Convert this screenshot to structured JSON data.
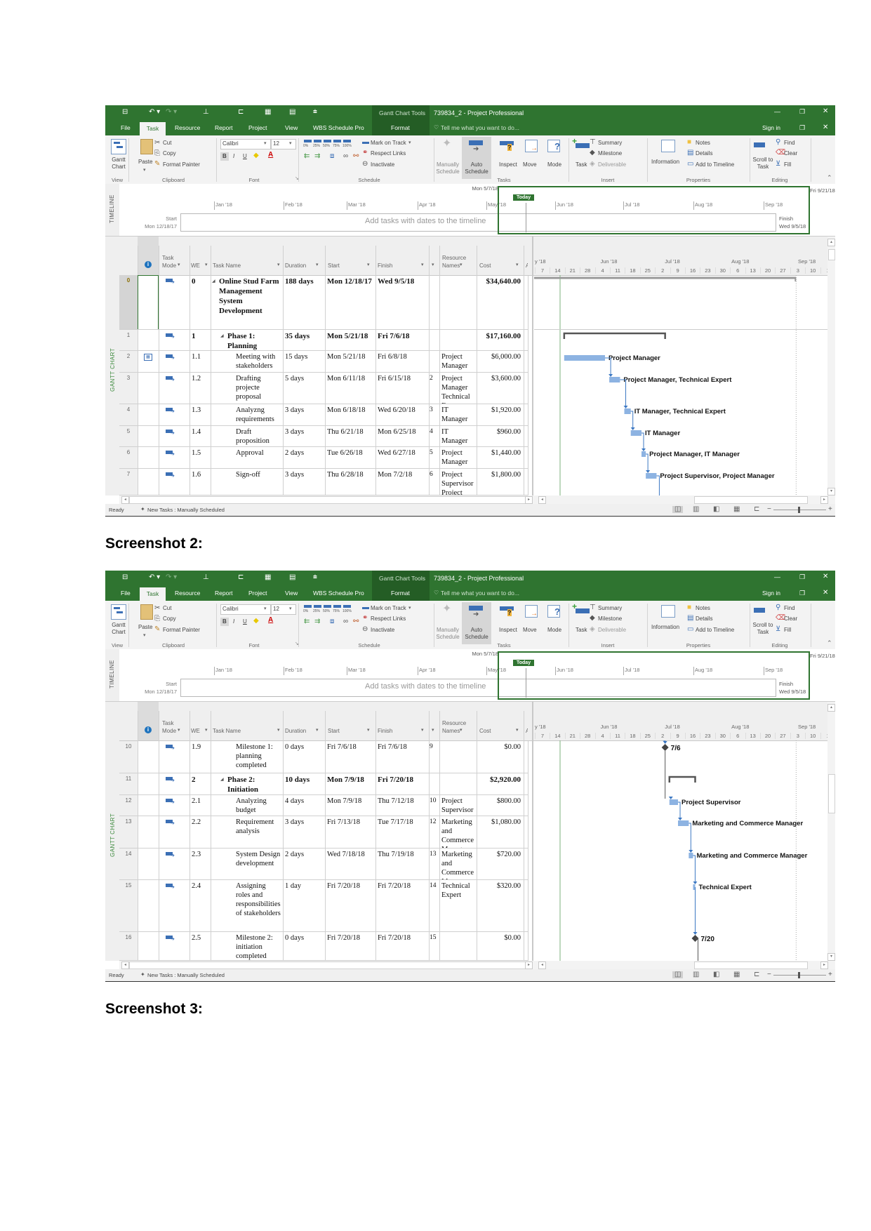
{
  "document": {
    "heading_2": "Screenshot 2:",
    "heading_3": "Screenshot 3:"
  },
  "app": {
    "quick_access_icons": [
      "save-icon",
      "undo-icon",
      "redo-icon",
      "org-chart-icon",
      "outline-icon",
      "calendar-grid-icon",
      "table-icon",
      "customize-icon"
    ],
    "contextual_tab_group": "Gantt Chart Tools",
    "window_title": "739834_2 - Project Professional",
    "tabs": [
      "File",
      "Task",
      "Resource",
      "Report",
      "Project",
      "View",
      "WBS Schedule Pro",
      "Format"
    ],
    "active_tab": "Task",
    "tell_me_placeholder": "Tell me what you want to do...",
    "sign_in": "Sign in",
    "ribbon": {
      "groups": [
        "View",
        "Clipboard",
        "Font",
        "Schedule",
        "Tasks",
        "Insert",
        "Properties",
        "Editing"
      ],
      "gantt_chart": "Gantt Chart",
      "paste": "Paste",
      "cut": "Cut",
      "copy": "Copy",
      "format_painter": "Format Painter",
      "font_name": "Calibri",
      "font_size": "12",
      "bold": "B",
      "italic": "I",
      "underline": "U",
      "percent_complete": [
        "0%",
        "25%",
        "50%",
        "75%",
        "100%"
      ],
      "mark_on_track": "Mark on Track",
      "respect_links": "Respect Links",
      "inactivate": "Inactivate",
      "manually_schedule": "Manually Schedule",
      "auto_schedule": "Auto Schedule",
      "inspect": "Inspect",
      "move": "Move",
      "mode": "Mode",
      "task": "Task",
      "summary": "Summary",
      "milestone": "Milestone",
      "deliverable": "Deliverable",
      "information": "Information",
      "notes": "Notes",
      "details": "Details",
      "add_to_timeline": "Add to Timeline",
      "scroll_to_task": "Scroll to Task",
      "find": "Find",
      "clear": "Clear",
      "fill": "Fill"
    },
    "timeline": {
      "side_label": "TIMELINE",
      "current_date": "Mon 5/7/18",
      "today_badge": "Today",
      "months": [
        "Jan '18",
        "Feb '18",
        "Mar '18",
        "Apr '18",
        "May '18",
        "Jun '18",
        "Jul '18",
        "Aug '18",
        "Sep '18"
      ],
      "start_label": "Start",
      "start_date": "Mon 12/18/17",
      "finish_label": "Finish",
      "finish_date": "Wed 9/5/18",
      "placeholder": "Add tasks with dates to the timeline",
      "view_end_date": "Fri 9/21/18"
    },
    "side_label": "GANTT CHART",
    "columns": {
      "indicators_icon": "info-icon",
      "task_mode": "Task\nMode",
      "wbs": "WE",
      "task_name": "Task Name",
      "duration": "Duration",
      "start": "Start",
      "finish": "Finish",
      "resource_names": "Resource\nNames",
      "cost": "Cost",
      "add_new_column": "A"
    },
    "gantt_timescale": {
      "months": [
        "y '18",
        "Jun '18",
        "Jul '18",
        "Aug '18",
        "Sep '18"
      ],
      "weeks": [
        "7",
        "14",
        "21",
        "28",
        "4",
        "11",
        "18",
        "25",
        "2",
        "9",
        "16",
        "23",
        "30",
        "6",
        "13",
        "20",
        "27",
        "3",
        "10",
        "1"
      ]
    },
    "status": {
      "ready": "Ready",
      "new_tasks": "New Tasks : Manually Scheduled",
      "view_icons": [
        "gantt-view-icon",
        "task-usage-icon",
        "team-planner-icon",
        "resource-sheet-icon",
        "report-icon"
      ],
      "zoom_minus": "−",
      "zoom_plus": "+"
    },
    "colors": {
      "title_bar": "#2f7430",
      "contextual_band": "#245d25",
      "task_bar": "#8db3e2",
      "link_line": "#3c78c3",
      "today_line": "#7cb27c",
      "summary_bar": "#555555"
    }
  },
  "screenshots": [
    {
      "rows": [
        {
          "id": "0",
          "indicator": "",
          "wbs": "0",
          "name": "Online Stud Farm Management System Development",
          "duration": "188 days",
          "start": "Mon 12/18/17",
          "finish": "Wed 9/5/18",
          "predecessors": "",
          "resource_names": "",
          "cost": "$34,640.00",
          "type": "project-summary",
          "level": 0,
          "bar_label": ""
        },
        {
          "id": "1",
          "indicator": "",
          "wbs": "1",
          "name": "Phase 1: Planning",
          "duration": "35 days",
          "start": "Mon 5/21/18",
          "finish": "Fri 7/6/18",
          "predecessors": "",
          "resource_names": "",
          "cost": "$17,160.00",
          "type": "summary",
          "level": 1,
          "bar_label": ""
        },
        {
          "id": "2",
          "indicator": "calendar-icon",
          "wbs": "1.1",
          "name": "Meeting with stakeholders",
          "duration": "15 days",
          "start": "Mon 5/21/18",
          "finish": "Fri 6/8/18",
          "predecessors": "",
          "resource_names": "Project Manager",
          "cost": "$6,000.00",
          "type": "task",
          "level": 2,
          "bar_label": "Project Manager"
        },
        {
          "id": "3",
          "indicator": "",
          "wbs": "1.2",
          "name": "Drafting projecte proposal",
          "duration": "5 days",
          "start": "Mon 6/11/18",
          "finish": "Fri 6/15/18",
          "predecessors": "2",
          "resource_names": "Project Manager Technical Expert",
          "cost": "$3,600.00",
          "type": "task",
          "level": 2,
          "bar_label": "Project Manager, Technical Expert"
        },
        {
          "id": "4",
          "indicator": "",
          "wbs": "1.3",
          "name": "Analyzng requirements",
          "duration": "3 days",
          "start": "Mon 6/18/18",
          "finish": "Wed 6/20/18",
          "predecessors": "3",
          "resource_names": "IT Manager Technical Expert",
          "cost": "$1,920.00",
          "type": "task",
          "level": 2,
          "bar_label": "IT Manager, Technical Expert"
        },
        {
          "id": "5",
          "indicator": "",
          "wbs": "1.4",
          "name": "Draft proposition",
          "duration": "3 days",
          "start": "Thu 6/21/18",
          "finish": "Mon 6/25/18",
          "predecessors": "4",
          "resource_names": "IT Manager",
          "cost": "$960.00",
          "type": "task",
          "level": 2,
          "bar_label": "IT Manager"
        },
        {
          "id": "6",
          "indicator": "",
          "wbs": "1.5",
          "name": "Approval",
          "duration": "2 days",
          "start": "Tue 6/26/18",
          "finish": "Wed 6/27/18",
          "predecessors": "5",
          "resource_names": "Project Manager IT Manager",
          "cost": "$1,440.00",
          "type": "task",
          "level": 2,
          "bar_label": "Project Manager, IT Manager"
        },
        {
          "id": "7",
          "indicator": "",
          "wbs": "1.6",
          "name": "Sign-off",
          "duration": "3 days",
          "start": "Thu 6/28/18",
          "finish": "Mon 7/2/18",
          "predecessors": "6",
          "resource_names": "Project Supervisor Project Manager",
          "cost": "$1,800.00",
          "type": "task",
          "level": 2,
          "bar_label": "Project Supervisor, Project Manager"
        }
      ]
    },
    {
      "rows": [
        {
          "id": "10",
          "indicator": "",
          "wbs": "1.9",
          "name": "Milestone 1: planning completed",
          "duration": "0 days",
          "start": "Fri 7/6/18",
          "finish": "Fri 7/6/18",
          "predecessors": "9",
          "resource_names": "",
          "cost": "$0.00",
          "type": "milestone",
          "level": 2,
          "bar_label": "7/6"
        },
        {
          "id": "11",
          "indicator": "",
          "wbs": "2",
          "name": "Phase 2: Initiation",
          "duration": "10 days",
          "start": "Mon 7/9/18",
          "finish": "Fri 7/20/18",
          "predecessors": "",
          "resource_names": "",
          "cost": "$2,920.00",
          "type": "summary",
          "level": 1,
          "bar_label": ""
        },
        {
          "id": "12",
          "indicator": "",
          "wbs": "2.1",
          "name": "Analyzing budget",
          "duration": "4 days",
          "start": "Mon 7/9/18",
          "finish": "Thu 7/12/18",
          "predecessors": "10",
          "resource_names": "Project Supervisor",
          "cost": "$800.00",
          "type": "task",
          "level": 2,
          "bar_label": "Project Supervisor"
        },
        {
          "id": "13",
          "indicator": "",
          "wbs": "2.2",
          "name": "Requirement analysis",
          "duration": "3 days",
          "start": "Fri 7/13/18",
          "finish": "Tue 7/17/18",
          "predecessors": "12",
          "resource_names": "Marketing and Commerce Manager",
          "cost": "$1,080.00",
          "type": "task",
          "level": 2,
          "bar_label": "Marketing and Commerce Manager"
        },
        {
          "id": "14",
          "indicator": "",
          "wbs": "2.3",
          "name": "System Design development",
          "duration": "2 days",
          "start": "Wed 7/18/18",
          "finish": "Thu 7/19/18",
          "predecessors": "13",
          "resource_names": "Marketing and Commerce Manager",
          "cost": "$720.00",
          "type": "task",
          "level": 2,
          "bar_label": "Marketing and Commerce Manager"
        },
        {
          "id": "15",
          "indicator": "",
          "wbs": "2.4",
          "name": "Assigning roles and responsibilities of stakeholders",
          "duration": "1 day",
          "start": "Fri 7/20/18",
          "finish": "Fri 7/20/18",
          "predecessors": "14",
          "resource_names": "Technical Expert",
          "cost": "$320.00",
          "type": "task",
          "level": 2,
          "bar_label": "Technical Expert"
        },
        {
          "id": "16",
          "indicator": "",
          "wbs": "2.5",
          "name": "Milestone 2: initiation completed",
          "duration": "0 days",
          "start": "Fri 7/20/18",
          "finish": "Fri 7/20/18",
          "predecessors": "15",
          "resource_names": "",
          "cost": "$0.00",
          "type": "milestone",
          "level": 2,
          "bar_label": "7/20"
        }
      ]
    }
  ]
}
